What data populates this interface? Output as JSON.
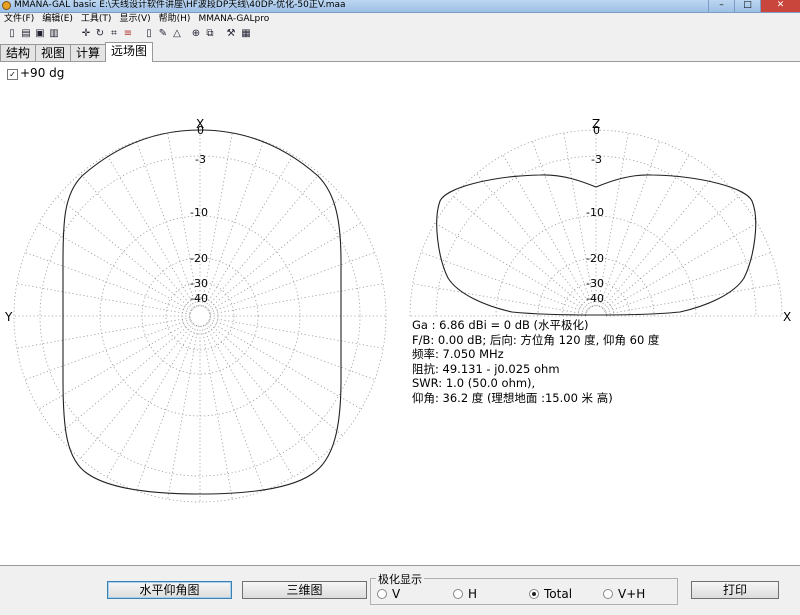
{
  "window": {
    "title": "MMANA-GAL basic  E:\\天线设计软件讲座\\HF波段DP天线\\40DP-优化-50正V.maa",
    "minimize": "–",
    "maximize": "□",
    "close": "✕"
  },
  "menu": [
    "文件(F)",
    "编辑(E)",
    "工具(T)",
    "显示(V)",
    "帮助(H)",
    "MMANA-GALpro"
  ],
  "toolbar_icons": [
    "new-file-icon",
    "open-folder-icon",
    "save-icon",
    "print-setup-icon",
    "move-icon",
    "rotate-icon",
    "zoom-icon",
    "wire-edit-icon",
    "document-icon",
    "edit-icon",
    "triangle-icon",
    "target-icon",
    "copy-icon",
    "tools-icon",
    "calculator-icon"
  ],
  "tabs": [
    "结构",
    "视图",
    "计算",
    "远场图"
  ],
  "active_tab": "远场图",
  "plot": {
    "checkbox_checked": true,
    "checkbox_label": "+90 dg",
    "horizontal": {
      "top_axis": "X",
      "left_axis": "Y",
      "ring_labels": [
        "0",
        "-3",
        "-10",
        "-20",
        "-30",
        "-40"
      ]
    },
    "vertical": {
      "top_axis": "Z",
      "right_axis": "X",
      "ring_labels": [
        "0",
        "-3",
        "-10",
        "-20",
        "-30",
        "-40"
      ]
    }
  },
  "info": {
    "gain": "Ga : 6.86 dBi = 0 dB  (水平极化)",
    "fb": "F/B: 0.00 dB; 后向: 方位角 120 度,  仰角 60 度",
    "freq": "频率: 7.050 MHz",
    "impedance": "阻抗: 49.131 - j0.025 ohm",
    "swr": "SWR: 1.0 (50.0 ohm),",
    "elevation": "仰角: 36.2 度 (理想地面  :15.00 米 高)"
  },
  "buttons": {
    "horizontal": "水平仰角图",
    "three_d": "三维图",
    "print": "打印"
  },
  "polarization": {
    "legend": "极化显示",
    "options": [
      "V",
      "H",
      "Total",
      "V+H"
    ],
    "selected": "Total"
  }
}
